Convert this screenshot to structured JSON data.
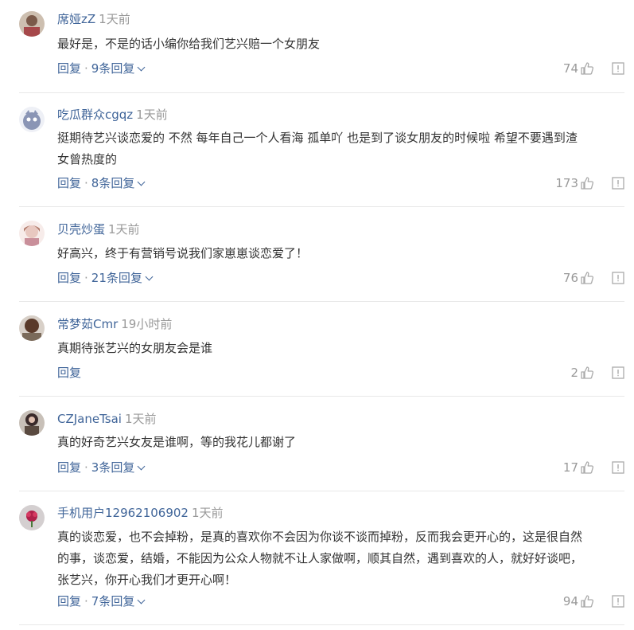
{
  "comments": [
    {
      "user": "席娅zZ",
      "time": "1天前",
      "lines": [
        "最好是，不是的话小编你给我们艺兴赔一个女朋友"
      ],
      "reply_label": "回复",
      "sep": "·",
      "more": "9条回复",
      "likes": "74",
      "avatar_color": "#7a5a4a"
    },
    {
      "user": "吃瓜群众cgqz",
      "time": "1天前",
      "lines": [
        "挺期待艺兴谈恋爱的 不然 每年自己一个人看海 孤单吖 也是到了谈女朋友的时候啦 希望不要遇到渣",
        "女曾热度的"
      ],
      "reply_label": "回复",
      "sep": "·",
      "more": "8条回复",
      "likes": "173",
      "avatar_color": "#8a95b5"
    },
    {
      "user": "贝壳炒蛋",
      "time": "1天前",
      "lines": [
        "好高兴，终于有营销号说我们家崽崽谈恋爱了！"
      ],
      "reply_label": "回复",
      "sep": "·",
      "more": "21条回复",
      "likes": "76",
      "avatar_color": "#e8c8c0"
    },
    {
      "user": "常梦茹Cmr",
      "time": "19小时前",
      "lines": [
        "真期待张艺兴的女朋友会是谁"
      ],
      "reply_label": "回复",
      "sep": "",
      "more": "",
      "likes": "2",
      "avatar_color": "#5a3a2a"
    },
    {
      "user": "CZJaneTsai",
      "time": "1天前",
      "lines": [
        "真的好奇艺兴女友是谁啊，等的我花儿都谢了"
      ],
      "reply_label": "回复",
      "sep": "·",
      "more": "3条回复",
      "likes": "17",
      "avatar_color": "#3a2a2a"
    },
    {
      "user": "手机用户12962106902",
      "time": "1天前",
      "lines": [
        "真的谈恋爱，也不会掉粉，是真的喜欢你不会因为你谈不谈而掉粉，反而我会更开心的，这是很自然",
        "的事，谈恋爱，结婚，不能因为公众人物就不让人家做啊，顺其自然，遇到喜欢的人，就好好谈吧，",
        "张艺兴，你开心我们才更开心啊！"
      ],
      "reply_label": "回复",
      "sep": "·",
      "more": "7条回复",
      "likes": "94",
      "avatar_color": "#d4cfd0"
    }
  ],
  "colors": {
    "link": "#406599",
    "muted": "#999999",
    "text": "#333333",
    "divider": "#e8e8e8"
  },
  "icons": {
    "like": "thumbs-up-icon",
    "report": "report-icon",
    "expand": "chevron-down-icon"
  }
}
